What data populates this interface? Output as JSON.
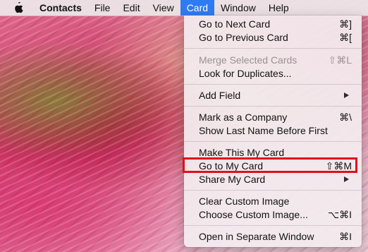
{
  "menubar": {
    "app_name": "Contacts",
    "items": [
      "File",
      "Edit",
      "View",
      "Card",
      "Window",
      "Help"
    ]
  },
  "menu": {
    "items": [
      {
        "label": "Go to Next Card",
        "shortcut": "⌘]"
      },
      {
        "label": "Go to Previous Card",
        "shortcut": "⌘["
      },
      {
        "label": "Merge Selected Cards",
        "shortcut": "⇧⌘L"
      },
      {
        "label": "Look for Duplicates...",
        "shortcut": ""
      },
      {
        "label": "Add Field",
        "shortcut": ""
      },
      {
        "label": "Mark as a Company",
        "shortcut": "⌘\\"
      },
      {
        "label": "Show Last Name Before First",
        "shortcut": ""
      },
      {
        "label": "Make This My Card",
        "shortcut": ""
      },
      {
        "label": "Go to My Card",
        "shortcut": "⇧⌘M"
      },
      {
        "label": "Share My Card",
        "shortcut": ""
      },
      {
        "label": "Clear Custom Image",
        "shortcut": ""
      },
      {
        "label": "Choose Custom Image...",
        "shortcut": "⌥⌘I"
      },
      {
        "label": "Open in Separate Window",
        "shortcut": "⌘I"
      }
    ]
  },
  "colors": {
    "menu_highlight": "#2f7bf3",
    "callout_border": "#e0101a"
  },
  "icons": {
    "apple": "apple-icon",
    "submenu": "chevron-right-icon"
  }
}
